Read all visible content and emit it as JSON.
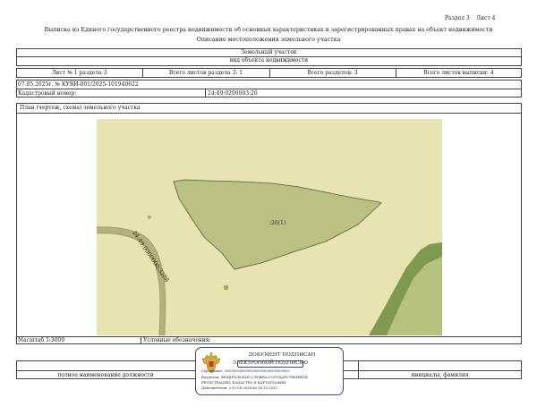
{
  "header": {
    "section_label": "Раздел 3",
    "sheet_label": "Лист 4",
    "title": "Выписка из Единого государственного реестра недвижимости об основных характеристиках и зарегистрированных правах на объект недвижимости",
    "subtitle": "Описание местоположения земельного участка"
  },
  "object": {
    "type": "Земельный участок",
    "type_caption": "вид объекта недвижимости"
  },
  "sheet_row": {
    "sheet_of_section": "Лист № 1 раздела 3",
    "total_sheets_section": "Всего листов раздела 3: 1",
    "total_sections": "Всего разделов: 3",
    "total_sheets_extract": "Всего листов выписки: 4"
  },
  "doc": {
    "date_number": "07.05.2025г. № КУВИ-001/2025-101940622",
    "cadastral_label": "Кадастровый номер:",
    "cadastral_value": "24:49:0200003:26"
  },
  "plan": {
    "title": "План (чертеж, схема) земельного участка",
    "parcel_label": ":26(1)",
    "road_label": "24:49:0000000:3288"
  },
  "footer": {
    "scale_label": "Масштаб 1:3000",
    "legend_label": "Условные обозначения:",
    "position_caption": "полное наименование должности",
    "signature_caption": "инициалы, фамилия"
  },
  "stamp": {
    "line1": "ДОКУМЕНТ ПОДПИСАН",
    "line2": "ЭЛЕКТРОННОЙ ПОДПИСЬЮ",
    "cert_line": "Сертификат: 00000000000000000000000000000000",
    "owner_line1": "Владелец: ФЕДЕРАЛЬНАЯ СЛУЖБА ГОСУДАРСТВЕННОЙ",
    "owner_line2": "РЕГИСТРАЦИИ, КАДАСТРА И КАРТОГРАФИИ",
    "valid_line": "Действителен: с 02.08.2024 по 26.10.2025"
  },
  "colors": {
    "map_background": "#e8e4b1",
    "parcel_fill": "#b9c183",
    "road_fill": "#b3b27a",
    "forest_dark": "#7e9a4e",
    "forest_light": "#b6c37c",
    "stamp_border": "#3a4a7a"
  },
  "icons": {
    "stamp_emblem": "russian-eagle-emblem"
  }
}
